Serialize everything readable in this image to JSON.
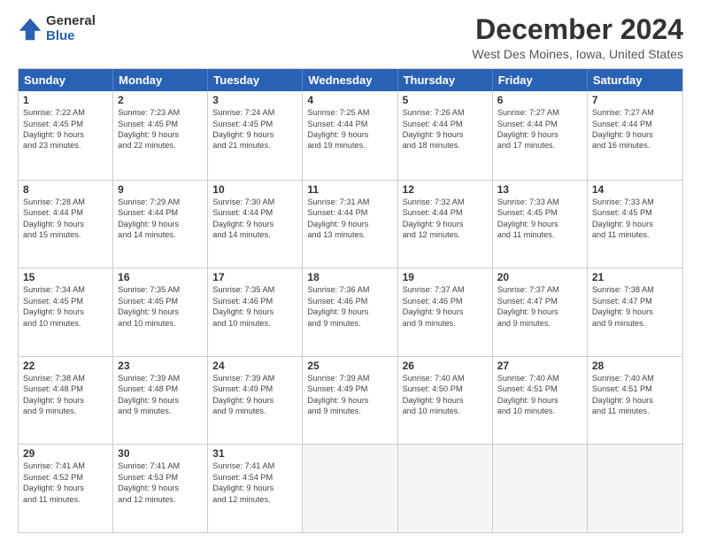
{
  "header": {
    "logo_general": "General",
    "logo_blue": "Blue",
    "month_title": "December 2024",
    "location": "West Des Moines, Iowa, United States"
  },
  "calendar": {
    "days_of_week": [
      "Sunday",
      "Monday",
      "Tuesday",
      "Wednesday",
      "Thursday",
      "Friday",
      "Saturday"
    ],
    "rows": [
      [
        {
          "day": "1",
          "lines": [
            "Sunrise: 7:22 AM",
            "Sunset: 4:45 PM",
            "Daylight: 9 hours",
            "and 23 minutes."
          ]
        },
        {
          "day": "2",
          "lines": [
            "Sunrise: 7:23 AM",
            "Sunset: 4:45 PM",
            "Daylight: 9 hours",
            "and 22 minutes."
          ]
        },
        {
          "day": "3",
          "lines": [
            "Sunrise: 7:24 AM",
            "Sunset: 4:45 PM",
            "Daylight: 9 hours",
            "and 21 minutes."
          ]
        },
        {
          "day": "4",
          "lines": [
            "Sunrise: 7:25 AM",
            "Sunset: 4:44 PM",
            "Daylight: 9 hours",
            "and 19 minutes."
          ]
        },
        {
          "day": "5",
          "lines": [
            "Sunrise: 7:26 AM",
            "Sunset: 4:44 PM",
            "Daylight: 9 hours",
            "and 18 minutes."
          ]
        },
        {
          "day": "6",
          "lines": [
            "Sunrise: 7:27 AM",
            "Sunset: 4:44 PM",
            "Daylight: 9 hours",
            "and 17 minutes."
          ]
        },
        {
          "day": "7",
          "lines": [
            "Sunrise: 7:27 AM",
            "Sunset: 4:44 PM",
            "Daylight: 9 hours",
            "and 16 minutes."
          ]
        }
      ],
      [
        {
          "day": "8",
          "lines": [
            "Sunrise: 7:28 AM",
            "Sunset: 4:44 PM",
            "Daylight: 9 hours",
            "and 15 minutes."
          ]
        },
        {
          "day": "9",
          "lines": [
            "Sunrise: 7:29 AM",
            "Sunset: 4:44 PM",
            "Daylight: 9 hours",
            "and 14 minutes."
          ]
        },
        {
          "day": "10",
          "lines": [
            "Sunrise: 7:30 AM",
            "Sunset: 4:44 PM",
            "Daylight: 9 hours",
            "and 14 minutes."
          ]
        },
        {
          "day": "11",
          "lines": [
            "Sunrise: 7:31 AM",
            "Sunset: 4:44 PM",
            "Daylight: 9 hours",
            "and 13 minutes."
          ]
        },
        {
          "day": "12",
          "lines": [
            "Sunrise: 7:32 AM",
            "Sunset: 4:44 PM",
            "Daylight: 9 hours",
            "and 12 minutes."
          ]
        },
        {
          "day": "13",
          "lines": [
            "Sunrise: 7:33 AM",
            "Sunset: 4:45 PM",
            "Daylight: 9 hours",
            "and 11 minutes."
          ]
        },
        {
          "day": "14",
          "lines": [
            "Sunrise: 7:33 AM",
            "Sunset: 4:45 PM",
            "Daylight: 9 hours",
            "and 11 minutes."
          ]
        }
      ],
      [
        {
          "day": "15",
          "lines": [
            "Sunrise: 7:34 AM",
            "Sunset: 4:45 PM",
            "Daylight: 9 hours",
            "and 10 minutes."
          ]
        },
        {
          "day": "16",
          "lines": [
            "Sunrise: 7:35 AM",
            "Sunset: 4:45 PM",
            "Daylight: 9 hours",
            "and 10 minutes."
          ]
        },
        {
          "day": "17",
          "lines": [
            "Sunrise: 7:35 AM",
            "Sunset: 4:46 PM",
            "Daylight: 9 hours",
            "and 10 minutes."
          ]
        },
        {
          "day": "18",
          "lines": [
            "Sunrise: 7:36 AM",
            "Sunset: 4:46 PM",
            "Daylight: 9 hours",
            "and 9 minutes."
          ]
        },
        {
          "day": "19",
          "lines": [
            "Sunrise: 7:37 AM",
            "Sunset: 4:46 PM",
            "Daylight: 9 hours",
            "and 9 minutes."
          ]
        },
        {
          "day": "20",
          "lines": [
            "Sunrise: 7:37 AM",
            "Sunset: 4:47 PM",
            "Daylight: 9 hours",
            "and 9 minutes."
          ]
        },
        {
          "day": "21",
          "lines": [
            "Sunrise: 7:38 AM",
            "Sunset: 4:47 PM",
            "Daylight: 9 hours",
            "and 9 minutes."
          ]
        }
      ],
      [
        {
          "day": "22",
          "lines": [
            "Sunrise: 7:38 AM",
            "Sunset: 4:48 PM",
            "Daylight: 9 hours",
            "and 9 minutes."
          ]
        },
        {
          "day": "23",
          "lines": [
            "Sunrise: 7:39 AM",
            "Sunset: 4:48 PM",
            "Daylight: 9 hours",
            "and 9 minutes."
          ]
        },
        {
          "day": "24",
          "lines": [
            "Sunrise: 7:39 AM",
            "Sunset: 4:49 PM",
            "Daylight: 9 hours",
            "and 9 minutes."
          ]
        },
        {
          "day": "25",
          "lines": [
            "Sunrise: 7:39 AM",
            "Sunset: 4:49 PM",
            "Daylight: 9 hours",
            "and 9 minutes."
          ]
        },
        {
          "day": "26",
          "lines": [
            "Sunrise: 7:40 AM",
            "Sunset: 4:50 PM",
            "Daylight: 9 hours",
            "and 10 minutes."
          ]
        },
        {
          "day": "27",
          "lines": [
            "Sunrise: 7:40 AM",
            "Sunset: 4:51 PM",
            "Daylight: 9 hours",
            "and 10 minutes."
          ]
        },
        {
          "day": "28",
          "lines": [
            "Sunrise: 7:40 AM",
            "Sunset: 4:51 PM",
            "Daylight: 9 hours",
            "and 11 minutes."
          ]
        }
      ],
      [
        {
          "day": "29",
          "lines": [
            "Sunrise: 7:41 AM",
            "Sunset: 4:52 PM",
            "Daylight: 9 hours",
            "and 11 minutes."
          ]
        },
        {
          "day": "30",
          "lines": [
            "Sunrise: 7:41 AM",
            "Sunset: 4:53 PM",
            "Daylight: 9 hours",
            "and 12 minutes."
          ]
        },
        {
          "day": "31",
          "lines": [
            "Sunrise: 7:41 AM",
            "Sunset: 4:54 PM",
            "Daylight: 9 hours",
            "and 12 minutes."
          ]
        },
        {
          "day": "",
          "lines": []
        },
        {
          "day": "",
          "lines": []
        },
        {
          "day": "",
          "lines": []
        },
        {
          "day": "",
          "lines": []
        }
      ]
    ]
  }
}
